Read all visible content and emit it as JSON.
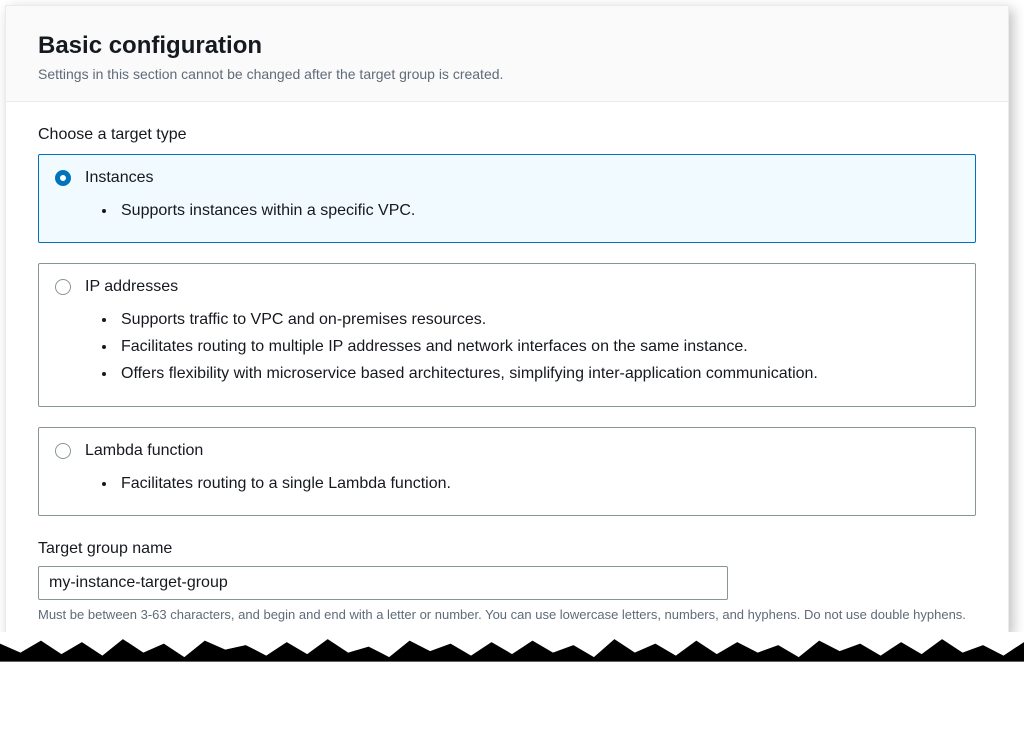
{
  "header": {
    "title": "Basic configuration",
    "subtitle": "Settings in this section cannot be changed after the target group is created."
  },
  "target_type": {
    "label": "Choose a target type",
    "options": [
      {
        "title": "Instances",
        "selected": true,
        "bullets": [
          "Supports instances within a specific VPC."
        ]
      },
      {
        "title": "IP addresses",
        "selected": false,
        "bullets": [
          "Supports traffic to VPC and on-premises resources.",
          "Facilitates routing to multiple IP addresses and network interfaces on the same instance.",
          "Offers flexibility with microservice based architectures, simplifying inter-application communication."
        ]
      },
      {
        "title": "Lambda function",
        "selected": false,
        "bullets": [
          "Facilitates routing to a single Lambda function."
        ]
      }
    ]
  },
  "target_group_name": {
    "label": "Target group name",
    "value": "my-instance-target-group",
    "hint": "Must be between 3-63 characters, and begin and end with a letter or number. You can use lowercase letters, numbers, and hyphens. Do not use double hyphens."
  },
  "colors": {
    "accent": "#0073bb",
    "border_default": "#879596",
    "text_primary": "#16191f",
    "text_secondary": "#5f6b7a",
    "selected_bg": "#f1faff"
  }
}
